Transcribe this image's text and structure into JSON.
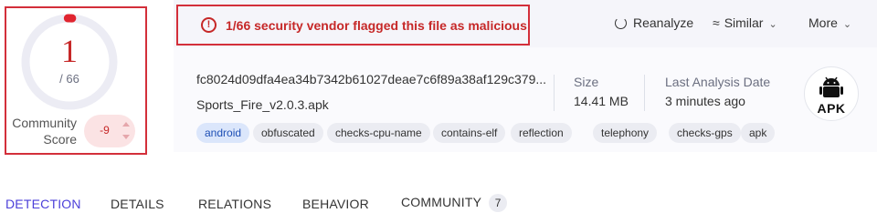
{
  "score": {
    "detections": "1",
    "total": "/ 66",
    "community_label": "Community Score",
    "community_value": "-9",
    "detection_ratio": 0.0152
  },
  "alert": {
    "icon": "exclamation-circle-icon",
    "text": "1/66 security vendor flagged this file as malicious"
  },
  "header": {
    "reanalyze_label": "Reanalyze",
    "similar_label": "Similar",
    "more_label": "More"
  },
  "file": {
    "hash": "fc8024d09dfa4ea34b7342b61027deae7c6f89a38af129c379...",
    "name": "Sports_Fire_v2.0.3.apk",
    "size_label": "Size",
    "size_value": "14.41 MB",
    "date_label": "Last Analysis Date",
    "date_value": "3 minutes ago",
    "type_badge": "APK"
  },
  "tags": [
    "android",
    "obfuscated",
    "checks-cpu-name",
    "contains-elf",
    "reflection",
    "telephony",
    "checks-gps",
    "apk"
  ],
  "tabs": [
    {
      "label": "DETECTION",
      "active": true
    },
    {
      "label": "DETAILS"
    },
    {
      "label": "RELATIONS"
    },
    {
      "label": "BEHAVIOR"
    },
    {
      "label": "COMMUNITY",
      "count": "7"
    }
  ],
  "colors": {
    "danger": "#c62828",
    "highlight_border": "#d32f3a",
    "active_tab": "#4b3fd9",
    "tag_highlight_bg": "#dbe6fb"
  }
}
